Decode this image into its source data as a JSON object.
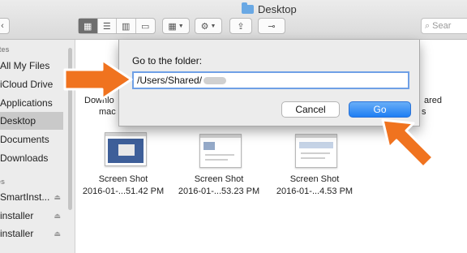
{
  "window": {
    "title": "Desktop"
  },
  "toolbar": {
    "search_placeholder": "Sear",
    "action_icon": "gear",
    "view_modes": [
      "icon",
      "list",
      "column",
      "cover-flow"
    ]
  },
  "sidebar": {
    "favorites_header": "ites",
    "devices_header": "es",
    "items": [
      {
        "label": "All My Files"
      },
      {
        "label": "iCloud Drive"
      },
      {
        "label": "Applications"
      },
      {
        "label": "Desktop",
        "selected": true
      },
      {
        "label": "Documents"
      },
      {
        "label": "Downloads"
      }
    ],
    "devices": [
      {
        "label": "SmartInst...",
        "eject": "⏏"
      },
      {
        "label": "installer",
        "eject": "⏏"
      },
      {
        "label": "installer",
        "eject": "⏏"
      }
    ]
  },
  "files_partial": {
    "left_line1": "Downlo",
    "left_line2": "mac",
    "right_line1": "ared",
    "right_line2": "s"
  },
  "files": [
    {
      "name": "Screen Shot",
      "date": "2016-01-...51.42 PM"
    },
    {
      "name": "Screen Shot",
      "date": "2016-01-...53.23 PM"
    },
    {
      "name": "Screen Shot",
      "date": "2016-01-...4.53 PM"
    }
  ],
  "dialog": {
    "label": "Go to the folder:",
    "path_value": "/Users/Shared/",
    "cancel_label": "Cancel",
    "go_label": "Go"
  },
  "colors": {
    "accent": "#1f7ef3",
    "arrow": "#f0731f"
  }
}
